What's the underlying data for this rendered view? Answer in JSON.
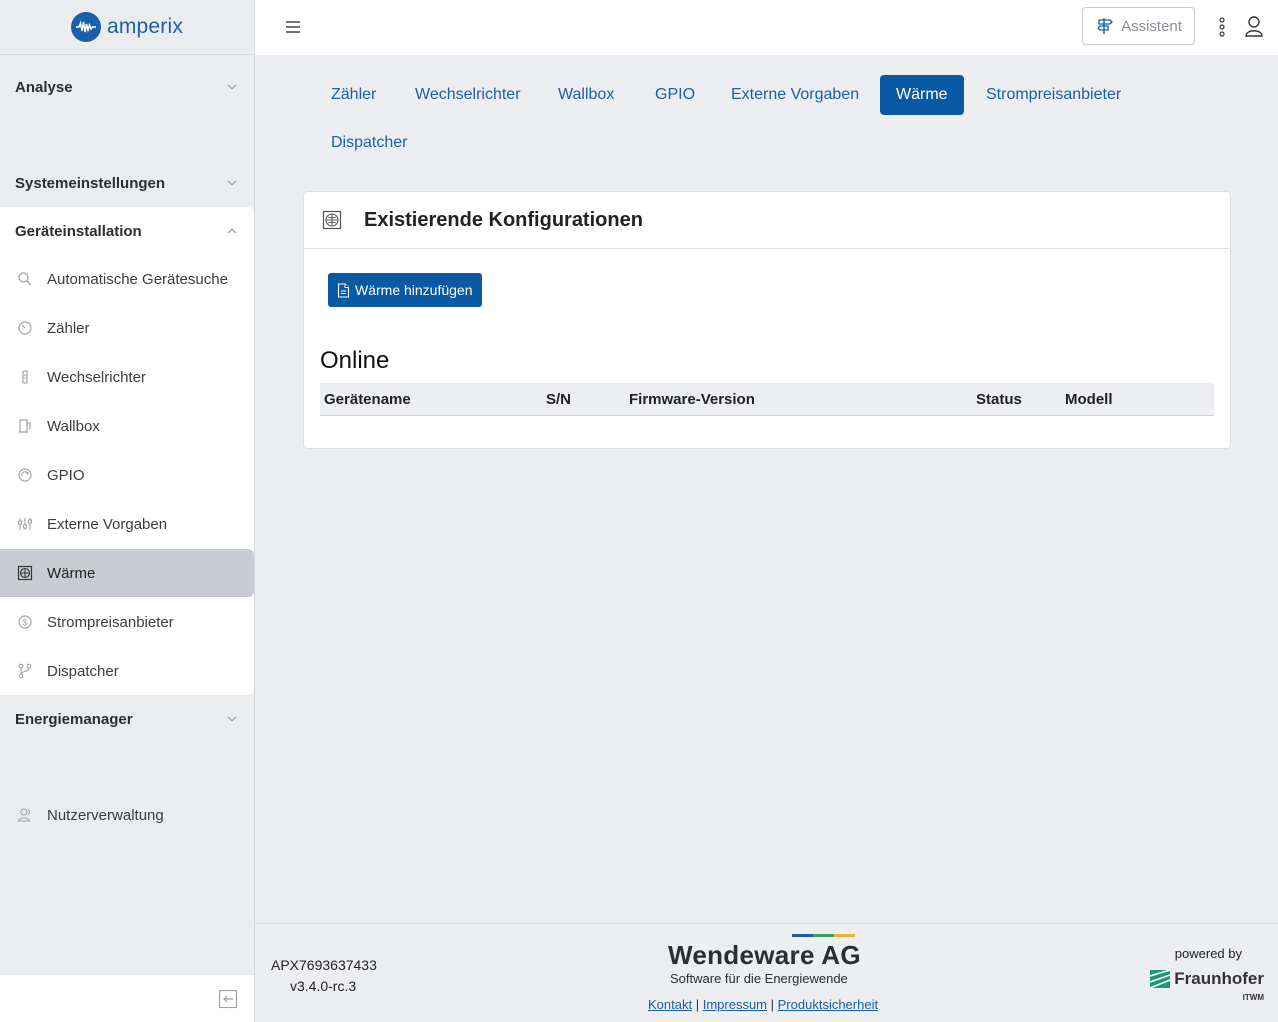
{
  "app": {
    "logo_text": "amperix"
  },
  "sidebar": {
    "sections": {
      "analyse": "Analyse",
      "systemeinstellungen": "Systemeinstellungen",
      "geraeteinstallation": "Geräteinstallation",
      "energiemanager": "Energiemanager"
    },
    "items": [
      {
        "label": "Automatische Gerätesuche",
        "icon": "search-icon"
      },
      {
        "label": "Zähler",
        "icon": "gauge-icon"
      },
      {
        "label": "Wechselrichter",
        "icon": "inverter-icon"
      },
      {
        "label": "Wallbox",
        "icon": "charging-station-icon"
      },
      {
        "label": "GPIO",
        "icon": "gpio-icon"
      },
      {
        "label": "Externe Vorgaben",
        "icon": "sliders-icon"
      },
      {
        "label": "Wärme",
        "icon": "heat-icon"
      },
      {
        "label": "Strompreisanbieter",
        "icon": "dollar-icon"
      },
      {
        "label": "Dispatcher",
        "icon": "branch-icon"
      }
    ],
    "active_item": "Wärme",
    "user_management": "Nutzerverwaltung"
  },
  "topbar": {
    "assistant_label": "Assistent"
  },
  "tabs": [
    "Zähler",
    "Wechselrichter",
    "Wallbox",
    "GPIO",
    "Externe Vorgaben",
    "Wärme",
    "Strompreisanbieter",
    "Dispatcher"
  ],
  "active_tab": "Wärme",
  "card": {
    "title": "Existierende Konfigurationen",
    "add_button": "Wärme hinzufügen",
    "online_title": "Online",
    "columns": [
      "Gerätename",
      "S/N",
      "Firmware-Version",
      "Status",
      "Modell"
    ],
    "rows": []
  },
  "footer": {
    "serial": "APX7693637433",
    "version": "v3.4.0-rc.3",
    "company": "Wendeware AG",
    "company_sub": "Software für die Energiewende",
    "links": [
      "Kontakt",
      "Impressum",
      "Produktsicherheit"
    ],
    "powered_by": "powered by",
    "partner": "Fraunhofer",
    "partner_sub": "ITWM"
  },
  "colors": {
    "accent": "#0a5aa3",
    "link": "#1a5fa8"
  }
}
